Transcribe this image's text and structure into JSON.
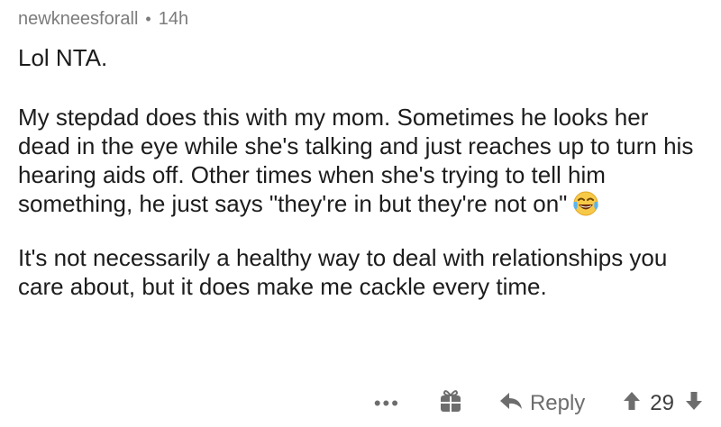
{
  "comment": {
    "username": "newkneesforall",
    "separator": "•",
    "age": "14h",
    "paragraphs": [
      "Lol NTA.",
      "My stepdad does this with my mom. Sometimes he looks her dead in the eye while she's talking and just reaches up to turn his hearing aids off.  Other times when she's trying to tell him something, he just says \"they're in but they're not on\"",
      "It's not necessarily a healthy way to deal with relationships you care about, but it does make me cackle every time."
    ],
    "emoji": "tears-of-joy-emoji"
  },
  "actions": {
    "more_label": "•••",
    "gift_icon": "gift-icon",
    "reply_label": "Reply",
    "score": "29"
  },
  "colors": {
    "text": "#1c1c1c",
    "meta": "#7c7c7c",
    "actions": "#6d6d6d",
    "emoji_face": "#f7c948"
  }
}
